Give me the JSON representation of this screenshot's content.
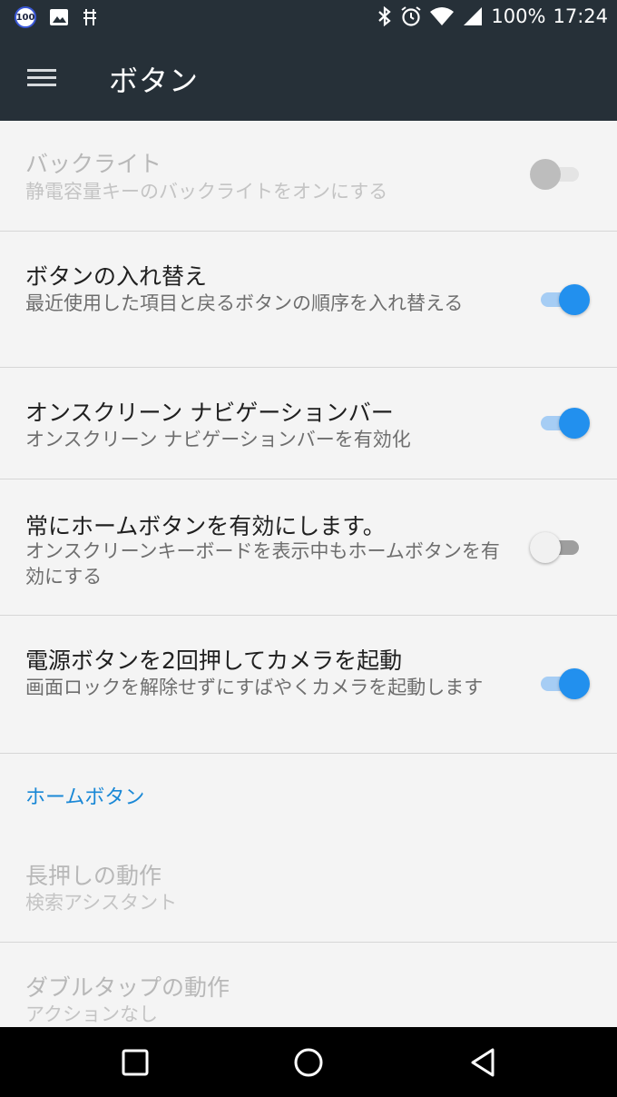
{
  "status_bar": {
    "battery_percent": "100%",
    "time": "17:24",
    "notification_badge": "100",
    "icons": [
      "battery-saver-badge-icon",
      "image-icon",
      "usb-debug-icon",
      "bluetooth-icon",
      "alarm-icon",
      "wifi-icon",
      "signal-icon"
    ]
  },
  "toolbar": {
    "title": "ボタン"
  },
  "items": [
    {
      "title": "バックライト",
      "subtitle": "静電容量キーのバックライトをオンにする",
      "state": "disabled"
    },
    {
      "title": "ボタンの入れ替え",
      "subtitle": "最近使用した項目と戻るボタンの順序を入れ替える",
      "state": "on"
    },
    {
      "title": "オンスクリーン ナビゲーションバー",
      "subtitle": "オンスクリーン ナビゲーションバーを有効化",
      "state": "on"
    },
    {
      "title": "常にホームボタンを有効にします。",
      "subtitle": "オンスクリーンキーボードを表示中もホームボタンを有効にする",
      "state": "off"
    },
    {
      "title": "電源ボタンを2回押してカメラを起動",
      "subtitle": "画面ロックを解除せずにすばやくカメラを起動します",
      "state": "on"
    }
  ],
  "section": {
    "title": "ホームボタン",
    "items": [
      {
        "title": "長押しの動作",
        "subtitle": "検索アシスタント"
      },
      {
        "title": "ダブルタップの動作",
        "subtitle": "アクションなし"
      }
    ]
  },
  "colors": {
    "toolbar_bg": "#263038",
    "accent": "#2290ee",
    "section_header": "#1a88d6"
  }
}
